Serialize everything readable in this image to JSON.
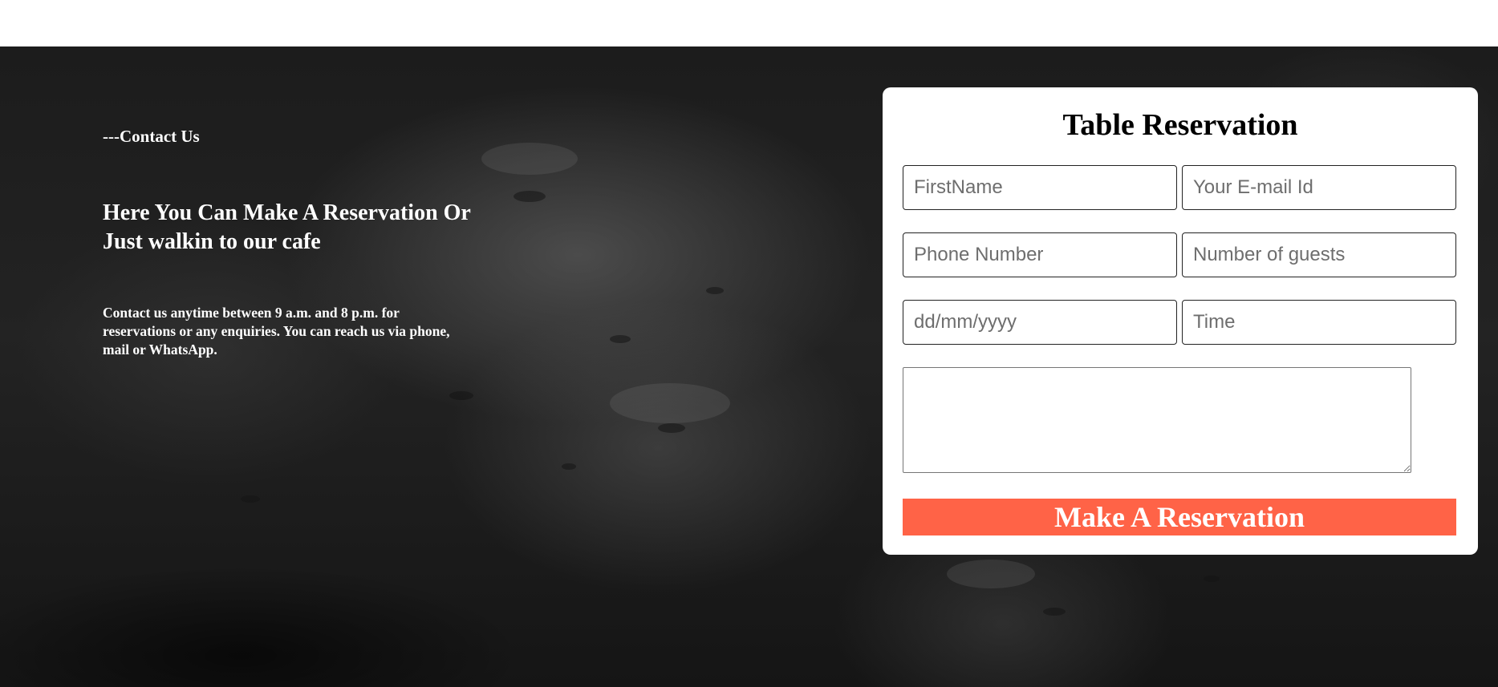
{
  "contact": {
    "label": "---Contact Us",
    "headline": "Here You Can Make A Reservation Or Just walkin to our cafe",
    "description": "Contact us anytime between 9 a.m. and 8 p.m. for reservations or any enquiries. You can reach us via phone, mail or WhatsApp."
  },
  "form": {
    "title": "Table Reservation",
    "first_name": {
      "placeholder": "FirstName",
      "value": ""
    },
    "email": {
      "placeholder": "Your E-mail Id",
      "value": ""
    },
    "phone": {
      "placeholder": "Phone Number",
      "value": ""
    },
    "guests": {
      "placeholder": "Number of guests",
      "value": ""
    },
    "date": {
      "placeholder": "dd/mm/yyyy",
      "value": ""
    },
    "time": {
      "placeholder": "Time",
      "value": ""
    },
    "message": {
      "placeholder": "",
      "value": ""
    },
    "submit_label": "Make A Reservation"
  },
  "colors": {
    "accent": "#ff6347",
    "card_background": "#ffffff",
    "hero_background": "#1c1c1c"
  }
}
